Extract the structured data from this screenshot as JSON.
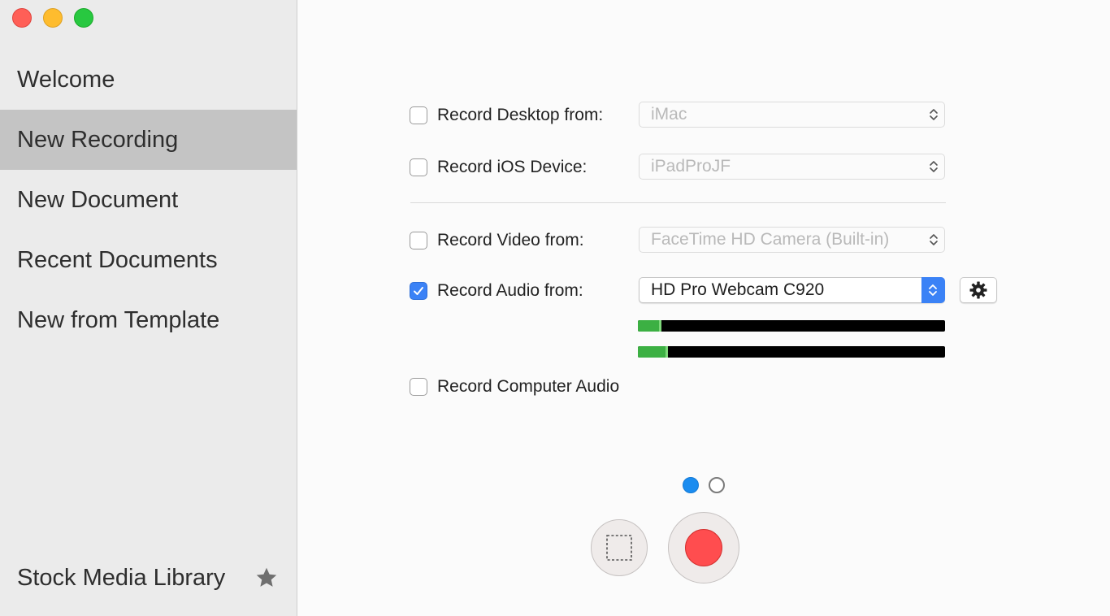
{
  "window": {
    "title": ""
  },
  "sidebar": {
    "items": [
      {
        "label": "Welcome",
        "active": false
      },
      {
        "label": "New Recording",
        "active": true
      },
      {
        "label": "New Document",
        "active": false
      },
      {
        "label": "Recent Documents",
        "active": false
      },
      {
        "label": "New from Template",
        "active": false
      }
    ],
    "footer": {
      "label": "Stock Media Library",
      "icon": "star-icon"
    }
  },
  "recording": {
    "desktop": {
      "label": "Record Desktop from:",
      "checked": false,
      "source": "iMac"
    },
    "ios": {
      "label": "Record iOS Device:",
      "checked": false,
      "source": "iPadProJF"
    },
    "video": {
      "label": "Record Video from:",
      "checked": false,
      "source": "FaceTime HD Camera (Built-in)"
    },
    "audio": {
      "label": "Record Audio from:",
      "checked": true,
      "source": "HD Pro Webcam C920",
      "levels": [
        0.07,
        0.09
      ]
    },
    "computer_audio": {
      "label": "Record Computer Audio",
      "checked": false
    }
  },
  "pager": {
    "pages": 2,
    "current": 1
  },
  "controls": {
    "region_icon": "selection-region-icon",
    "record_icon": "record-icon"
  },
  "colors": {
    "accent": "#3b82f6",
    "record": "#ff4d4f",
    "meter": "#3cb043",
    "selected_row": "#c4c4c4"
  }
}
